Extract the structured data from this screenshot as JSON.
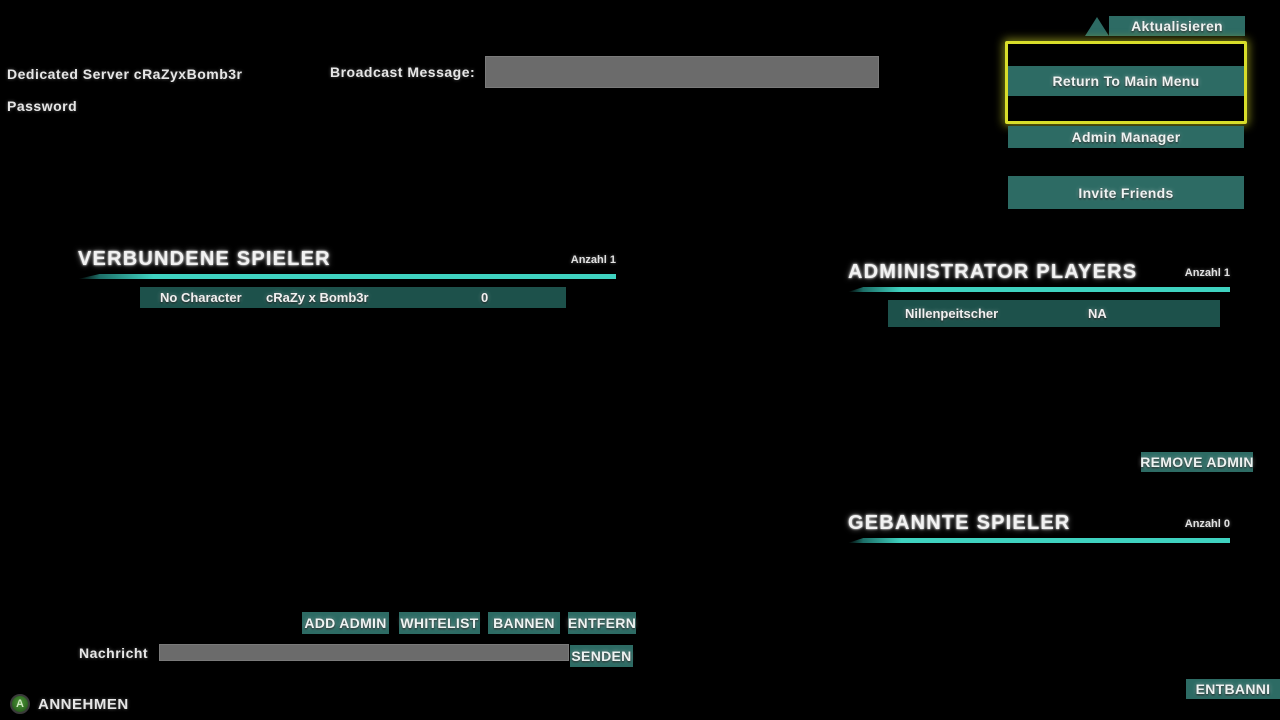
{
  "server": {
    "title": "Dedicated  Server  cRaZyxBomb3r",
    "password_label": "Password"
  },
  "broadcast": {
    "label": "Broadcast  Message:",
    "value": "",
    "placeholder": ""
  },
  "top_right": {
    "refresh_label": "Aktualisieren",
    "refresh_icon": "chevron-up-icon",
    "return_main_menu": "Return To Main Menu",
    "admin_manager": "Admin Manager",
    "invite_friends": "Invite Friends"
  },
  "connected_players": {
    "title": "VERBUNDENE  SPIELER",
    "count_label": "Anzahl 1",
    "rows": [
      {
        "character": "No Character",
        "name": "cRaZy x Bomb3r",
        "value": "0"
      }
    ]
  },
  "administrator_players": {
    "title": "ADMINISTRATOR  PLAYERS",
    "count_label": "Anzahl  1",
    "rows": [
      {
        "name": "Nillenpeitscher",
        "value": "NA"
      }
    ],
    "remove_admin_label": "REMOVE ADMIN"
  },
  "banned_players": {
    "title": "GEBANNTE  SPIELER",
    "count_label": "Anzahl  0",
    "rows": [],
    "unban_label": "ENTBANNI"
  },
  "action_buttons": {
    "add_admin": "ADD ADMIN",
    "whitelist": "WHITELIST",
    "ban": "BANNEN",
    "remove": "ENTFERN"
  },
  "message_bar": {
    "label": "Nachricht",
    "value": "",
    "placeholder": "",
    "send_label": "SENDEN"
  },
  "footer": {
    "accept_button_glyph": "A",
    "accept_label": "ANNEHMEN"
  },
  "colors": {
    "teal_button": "#2d6b64",
    "row_teal": "#1d514b",
    "accent_cyan": "#3fd2c0",
    "selection_yellow": "#d8dd2a",
    "field_gray": "#6b6b6b",
    "background": "#000000"
  }
}
